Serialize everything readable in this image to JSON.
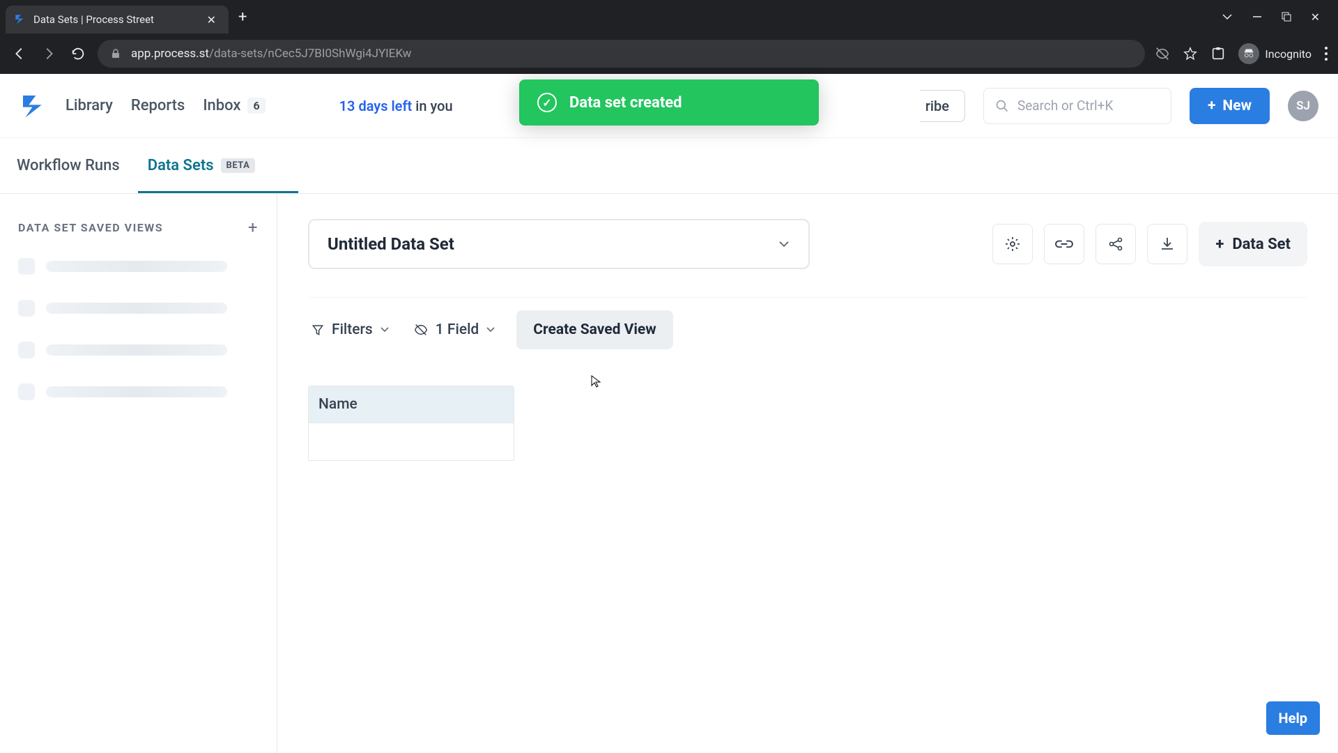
{
  "browser": {
    "tab_title": "Data Sets | Process Street",
    "url_host": "app.process.st",
    "url_path": "/data-sets/nCec5J7BI0ShWgi4JYIEKw",
    "incognito_label": "Incognito"
  },
  "header": {
    "nav": {
      "library": "Library",
      "reports": "Reports",
      "inbox": "Inbox",
      "inbox_count": "6"
    },
    "trial": {
      "days_prefix": "13 days left",
      "days_suffix": " in you"
    },
    "subscribe": "ribe",
    "search_placeholder": "Search or Ctrl+K",
    "new_label": "New",
    "avatar_initials": "SJ"
  },
  "toast": {
    "message": "Data set created"
  },
  "subtabs": {
    "workflow_runs": "Workflow Runs",
    "data_sets": "Data Sets",
    "beta": "BETA"
  },
  "sidebar": {
    "header": "DATA SET SAVED VIEWS"
  },
  "dataset": {
    "name": "Untitled Data Set",
    "new_label": "Data Set",
    "filters_label": "Filters",
    "fields_label": "1 Field",
    "save_view_label": "Create Saved View",
    "column_name": "Name"
  },
  "help": {
    "label": "Help"
  },
  "colors": {
    "accent": "#2a7de1",
    "teal": "#0e7490",
    "toast": "#22c55e"
  }
}
